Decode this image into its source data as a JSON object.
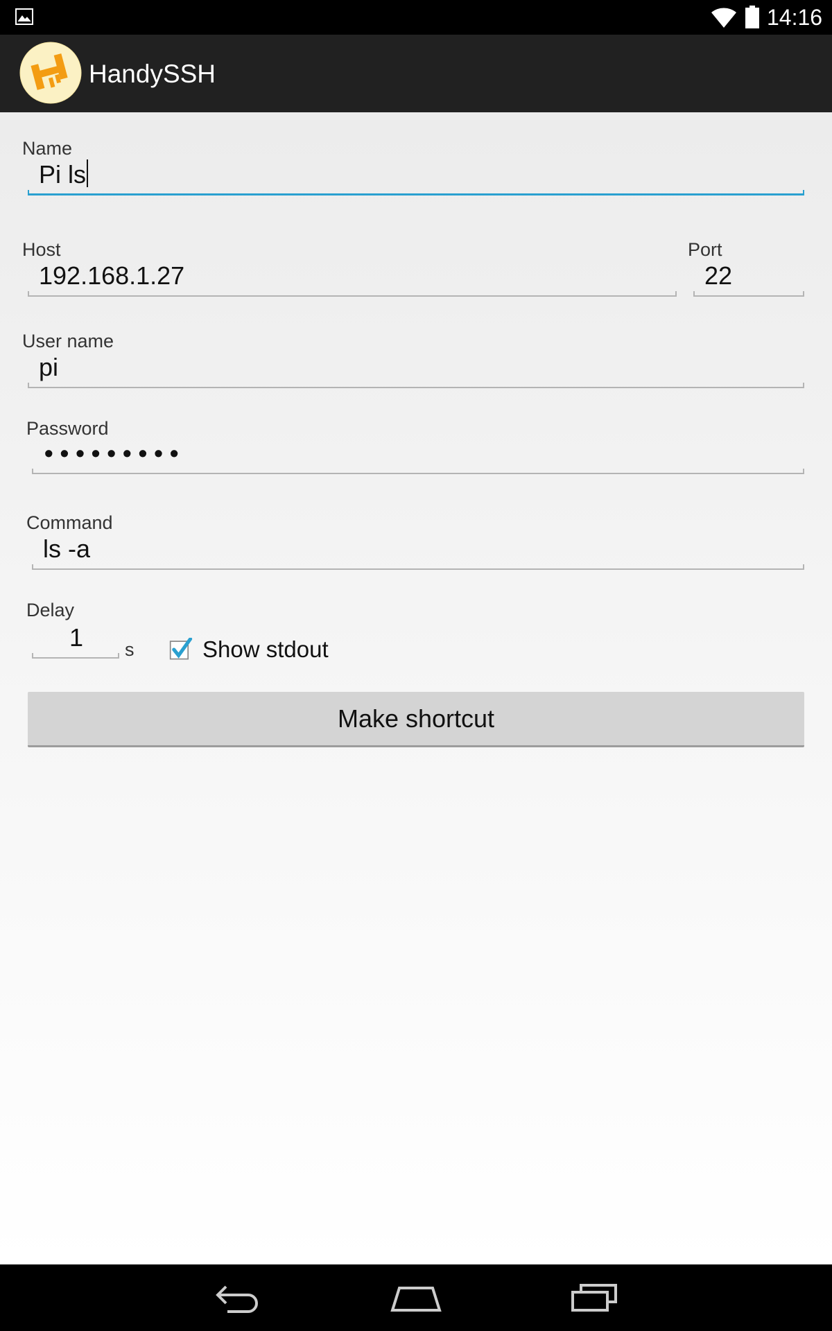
{
  "status_bar": {
    "time": "14:16",
    "icons": [
      "image-notification-icon",
      "wifi-icon",
      "battery-icon"
    ]
  },
  "action_bar": {
    "title": "HandySSH",
    "logo_icon": "handyssh-logo-icon"
  },
  "form": {
    "name_label": "Name",
    "name_value": "Pi ls",
    "host_label": "Host",
    "host_value": "192.168.1.27",
    "port_label": "Port",
    "port_value": "22",
    "username_label": "User name",
    "username_value": "pi",
    "password_label": "Password",
    "password_value": "•••••••••",
    "command_label": "Command",
    "command_value": "ls -a",
    "delay_label": "Delay",
    "delay_value": "1",
    "delay_unit": "s",
    "show_stdout_label": "Show stdout",
    "show_stdout_checked": true,
    "submit_label": "Make shortcut"
  },
  "nav_bar": {
    "buttons": [
      "back-icon",
      "home-icon",
      "recent-apps-icon"
    ]
  },
  "colors": {
    "accent": "#2aa0d0",
    "action_bar": "#212121",
    "logo": "#f39c12"
  }
}
